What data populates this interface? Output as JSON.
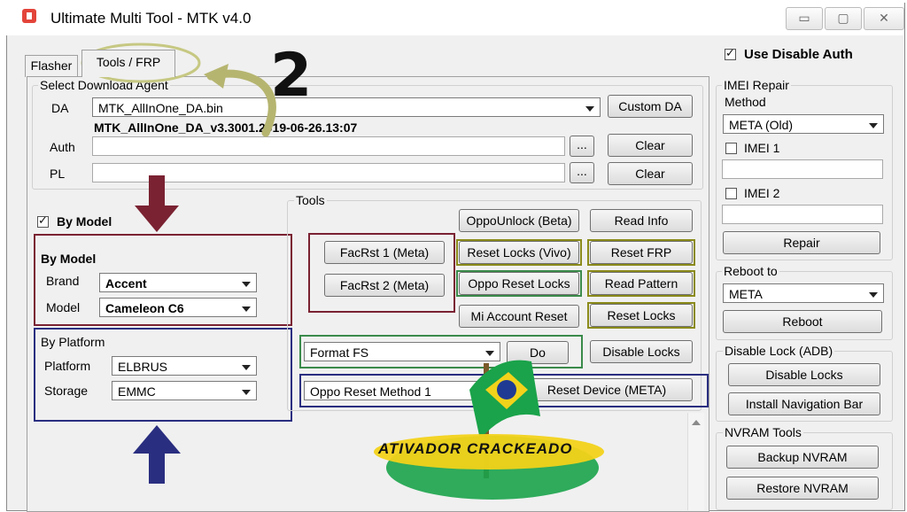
{
  "window": {
    "title": "Ultimate Multi Tool - MTK v4.0",
    "minimize": "▭",
    "maximize": "▢",
    "close": "✕"
  },
  "tabs": [
    {
      "label": "Flasher"
    },
    {
      "label": "Tools / FRP"
    }
  ],
  "download_agent": {
    "group_label": "Select Download Agent",
    "da_label": "DA",
    "da_value": "MTK_AllInOne_DA.bin",
    "da_version": "MTK_AllInOne_DA_v3.3001.2019-06-26.13:07",
    "custom_da_button": "Custom DA",
    "auth_label": "Auth",
    "pl_label": "PL",
    "browse_label": "...",
    "clear_label": "Clear"
  },
  "by_model_checkbox": "By Model",
  "by_model": {
    "group_label": "By Model",
    "brand_label": "Brand",
    "brand_value": "Accent",
    "model_label": "Model",
    "model_value": "Cameleon C6"
  },
  "by_platform": {
    "group_label": "By Platform",
    "platform_label": "Platform",
    "platform_value": "ELBRUS",
    "storage_label": "Storage",
    "storage_value": "EMMC"
  },
  "tools": {
    "group_label": "Tools",
    "oppo_unlock": "OppoUnlock (Beta)",
    "read_info": "Read Info",
    "facrst1": "FacRst 1 (Meta)",
    "facrst2": "FacRst 2 (Meta)",
    "reset_locks_vivo": "Reset Locks (Vivo)",
    "reset_frp": "Reset FRP",
    "oppo_reset_locks": "Oppo Reset Locks",
    "read_pattern": "Read Pattern",
    "mi_account_reset": "Mi Account Reset",
    "reset_locks": "Reset Locks",
    "format_value": "Format FS",
    "do": "Do",
    "disable_locks": "Disable Locks",
    "oppo_method_value": "Oppo Reset Method 1",
    "reset_device_meta": "Reset Device (META)"
  },
  "right_panel": {
    "use_disable_auth": "Use Disable Auth",
    "imei_repair_label": "IMEI Repair",
    "method_label": "Method",
    "method_value": "META (Old)",
    "imei1_label": "IMEI 1",
    "imei2_label": "IMEI 2",
    "repair": "Repair",
    "reboot_to_label": "Reboot to",
    "reboot_value": "META",
    "reboot": "Reboot",
    "disable_lock_label": "Disable Lock (ADB)",
    "disable_locks": "Disable Locks",
    "install_nav_bar": "Install Navigation Bar",
    "nvram_label": "NVRAM Tools",
    "backup_nvram": "Backup NVRAM",
    "restore_nvram": "Restore NVRAM"
  },
  "annotations": {
    "number": "2",
    "watermark": "ATIVADOR CRACKEADO"
  },
  "colors": {
    "maroon": "#7a2232",
    "olive": "#8a8a1a",
    "green": "#3a8a4a",
    "navy": "#2a2e80",
    "brazil_green": "#1aa34a",
    "brazil_yellow": "#f2d21a",
    "brazil_blue": "#1f3a93"
  }
}
